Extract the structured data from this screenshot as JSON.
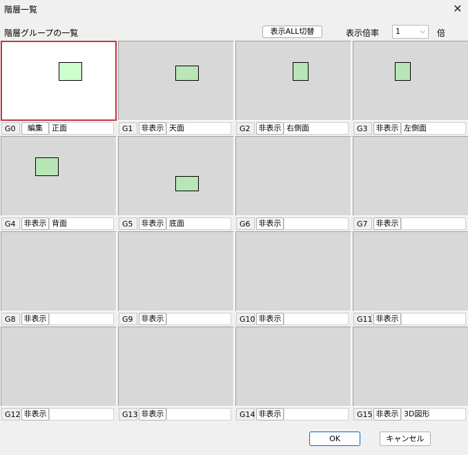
{
  "window": {
    "title": "階層一覧",
    "close_glyph": "✕"
  },
  "header": {
    "group_label": "階層グループの一覧",
    "toggle_all_label": "表示ALL切替",
    "zoom_label": "表示倍率",
    "zoom_value": "1",
    "zoom_unit": "倍"
  },
  "groups": [
    {
      "id": "G0",
      "mode": "編集",
      "name": "正面"
    },
    {
      "id": "G1",
      "mode": "非表示",
      "name": "天面"
    },
    {
      "id": "G2",
      "mode": "非表示",
      "name": "右側面"
    },
    {
      "id": "G3",
      "mode": "非表示",
      "name": "左側面"
    },
    {
      "id": "G4",
      "mode": "非表示",
      "name": "背面"
    },
    {
      "id": "G5",
      "mode": "非表示",
      "name": "底面"
    },
    {
      "id": "G6",
      "mode": "非表示",
      "name": ""
    },
    {
      "id": "G7",
      "mode": "非表示",
      "name": ""
    },
    {
      "id": "G8",
      "mode": "非表示",
      "name": ""
    },
    {
      "id": "G9",
      "mode": "非表示",
      "name": ""
    },
    {
      "id": "G10",
      "mode": "非表示",
      "name": ""
    },
    {
      "id": "G11",
      "mode": "非表示",
      "name": ""
    },
    {
      "id": "G12",
      "mode": "非表示",
      "name": ""
    },
    {
      "id": "G13",
      "mode": "非表示",
      "name": ""
    },
    {
      "id": "G14",
      "mode": "非表示",
      "name": ""
    },
    {
      "id": "G15",
      "mode": "非表示",
      "name": "3D図形"
    }
  ],
  "footer": {
    "ok_label": "OK",
    "cancel_label": "キャンセル"
  },
  "colors": {
    "active_border": "#c4343b",
    "shape_fill": "#b8e6b6",
    "active_shape_fill": "#ccffcc"
  }
}
